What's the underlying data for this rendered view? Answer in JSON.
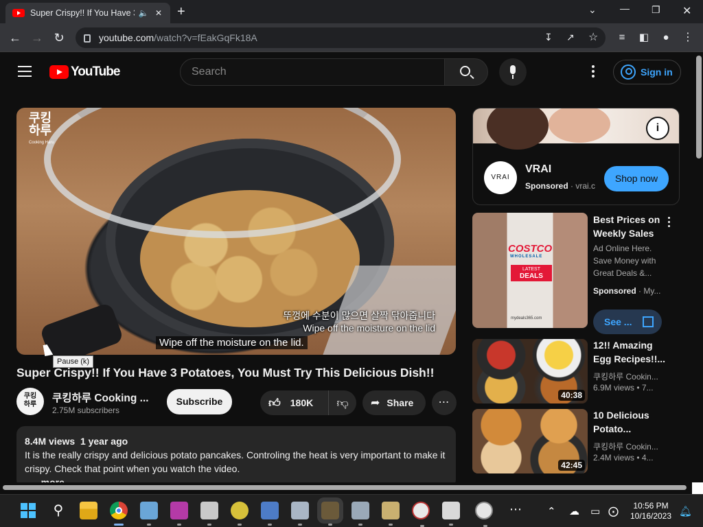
{
  "browser": {
    "tab_title": "Super Crispy!! If You Have 3",
    "url_host": "youtube.com",
    "url_path": "/watch?v=fEakGqFk18A",
    "icons": [
      "youtube-favicon",
      "speaker-icon",
      "close-icon",
      "plus-icon",
      "back-icon",
      "forward-icon",
      "reload-icon",
      "lock-icon",
      "install-icon",
      "share-icon",
      "star-icon",
      "reading-list-icon",
      "sidebar-icon",
      "profile-icon",
      "menu-icon"
    ]
  },
  "yt": {
    "logo_text": "YouTube",
    "search_placeholder": "Search",
    "signin_label": "Sign in"
  },
  "video": {
    "watermark_line1": "쿠킹",
    "watermark_line2": "하루",
    "watermark_small": "Cooking Haru",
    "subtitle_kr": "뚜껑에 수분이 많으면 살짝 닦아줍니다",
    "subtitle_en_burned": "Wipe off the moisture on the lid",
    "caption": "Wipe off the moisture on the lid.",
    "tooltip": "Pause (k)",
    "title": "Super Crispy!! If You Have 3 Potatoes, You Must Try This Delicious Dish!!",
    "channel_name": "쿠킹하루 Cooking ...",
    "channel_avatar_text": "쿠킹\n하루",
    "subscribers": "2.75M subscribers",
    "subscribe_label": "Subscribe",
    "likes": "180K",
    "share_label": "Share",
    "views": "8.4M views",
    "age": "1 year ago",
    "description": "It is the really crispy and delicious potato pancakes. Controling the heat is very important to make it crispy. Check that point when you watch the video.",
    "more_label": "...more"
  },
  "ad": {
    "logo_text": "VRAI",
    "brand": "VRAI",
    "sponsored": "Sponsored",
    "domain": "vrai.c",
    "cta": "Shop now",
    "info_icon": "i"
  },
  "suggestions": [
    {
      "title": "Best Prices on Weekly Sales",
      "line1": "Ad Online Here.",
      "line2": "Save Money with",
      "line3": "Great Deals &...",
      "sponsored": "Sponsored",
      "advertiser": "· My...",
      "cta": "See ...",
      "thumb_brand": "COSTCO",
      "thumb_sub": "WHOLESALE",
      "thumb_badge1": "LATEST",
      "thumb_badge2": "DEALS",
      "thumb_url": "mydeals365.com"
    },
    {
      "title": "12!! Amazing Egg Recipes!!...",
      "channel": "쿠킹하루 Cookin...",
      "meta": "6.9M views  • 7...",
      "duration": "40:38"
    },
    {
      "title": "10 Delicious Potato...",
      "channel": "쿠킹하루 Cookin...",
      "meta": "2.4M views  • 4...",
      "duration": "42:45"
    }
  ],
  "taskbar": {
    "time": "10:56 PM",
    "date": "10/16/2023"
  }
}
